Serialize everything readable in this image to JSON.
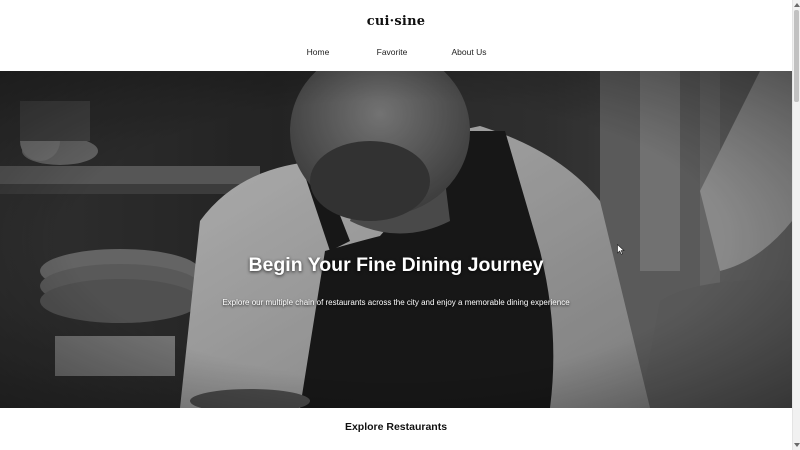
{
  "header": {
    "logo": "cui·sine",
    "nav": [
      {
        "label": "Home"
      },
      {
        "label": "Favorite"
      },
      {
        "label": "About Us"
      }
    ]
  },
  "hero": {
    "title": "Begin Your Fine Dining Journey",
    "subtitle": "Explore our multiple chain of restaurants across the city and enjoy a memorable dining experience",
    "image": "chef-in-kitchen-grayscale-photo"
  },
  "explore": {
    "heading": "Explore Restaurants"
  },
  "colors": {
    "header_bg": "#ffffff",
    "text_dark": "#111111",
    "hero_text": "#ffffff"
  }
}
